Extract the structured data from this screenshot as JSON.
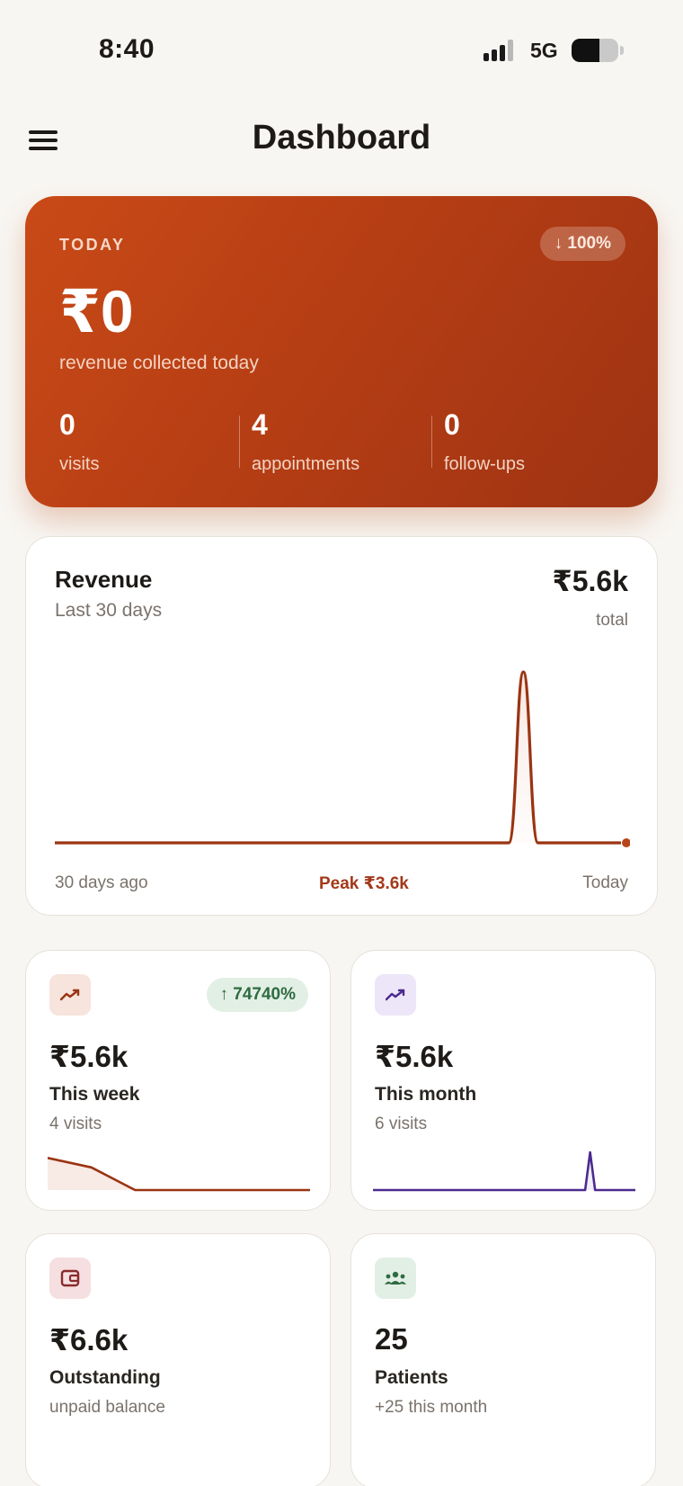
{
  "status_bar": {
    "time": "8:40",
    "network": "5G"
  },
  "header": {
    "title": "Dashboard",
    "menu_icon": "hamburger-menu-icon"
  },
  "today": {
    "label": "TODAY",
    "change": "↓ 100%",
    "revenue": "₹0",
    "revenue_caption": "revenue collected today",
    "stats": [
      {
        "value": "0",
        "label": "visits"
      },
      {
        "value": "4",
        "label": "appointments"
      },
      {
        "value": "0",
        "label": "follow-ups"
      }
    ],
    "colors": {
      "gradient_start": "#c94a17",
      "gradient_end": "#9e3313"
    }
  },
  "revenue": {
    "title": "Revenue",
    "subtitle": "Last 30 days",
    "total": "₹5.6k",
    "total_label": "total",
    "axis_start": "30 days ago",
    "peak_label": "Peak ₹3.6k",
    "axis_end": "Today",
    "line_color": "#9a3412"
  },
  "chart_data": {
    "type": "line",
    "x": [
      1,
      2,
      3,
      4,
      5,
      6,
      7,
      8,
      9,
      10,
      11,
      12,
      13,
      14,
      15,
      16,
      17,
      18,
      19,
      20,
      21,
      22,
      23,
      24,
      25,
      26,
      27,
      28,
      29,
      30
    ],
    "values": [
      0,
      0,
      0,
      0,
      0,
      0,
      0,
      0,
      0,
      0,
      0,
      0,
      0,
      0,
      0,
      0,
      0,
      0,
      0,
      0,
      0,
      0,
      0,
      0,
      3600,
      0,
      0,
      0,
      0,
      0
    ],
    "xlabel": "",
    "ylabel": "",
    "peak": 3600,
    "grid": false
  },
  "cards": {
    "week": {
      "icon": "trend-up-icon",
      "growth": "↑ 74740%",
      "value": "₹5.6k",
      "label": "This week",
      "sub": "4 visits",
      "spark": [
        0.85,
        0.6,
        0,
        0,
        0,
        0,
        0
      ],
      "color": "#9a3412"
    },
    "month": {
      "icon": "trend-up-icon",
      "value": "₹5.6k",
      "label": "This month",
      "sub": "6 visits",
      "spark": [
        0,
        0,
        0,
        0,
        0,
        0,
        0,
        0,
        0,
        0,
        0,
        0,
        0,
        0,
        0,
        0,
        0,
        0,
        0,
        0,
        0,
        0,
        0,
        0,
        1,
        0,
        0,
        0,
        0,
        0
      ],
      "color": "#4c2a8f"
    },
    "outstanding": {
      "icon": "wallet-icon",
      "value": "₹6.6k",
      "label": "Outstanding",
      "sub": "unpaid balance"
    },
    "patients": {
      "icon": "patients-group-icon",
      "value": "25",
      "label": "Patients",
      "sub": "+25 this month"
    }
  }
}
